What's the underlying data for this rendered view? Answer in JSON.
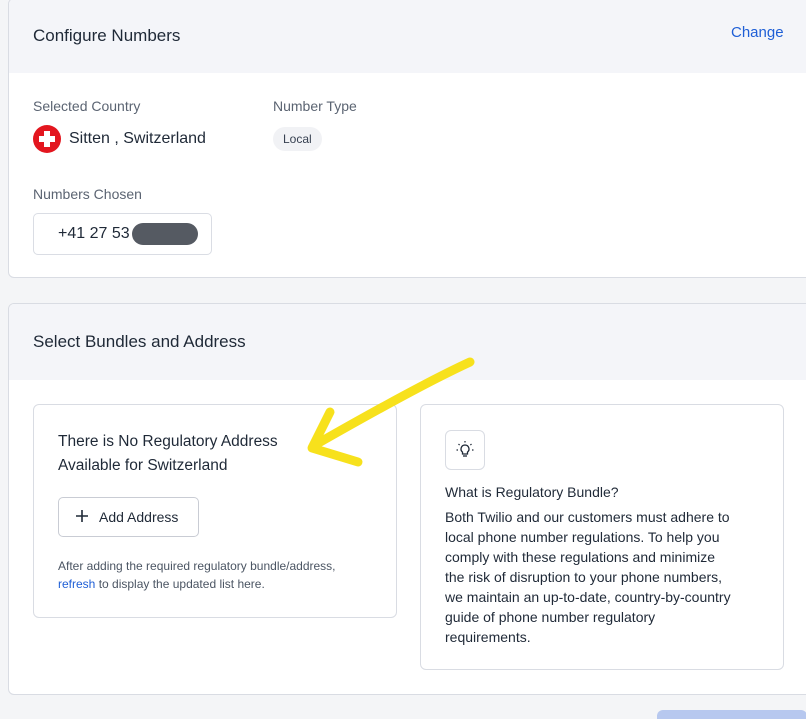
{
  "configure": {
    "title": "Configure Numbers",
    "change_label": "Change",
    "selected_country_label": "Selected Country",
    "country_value": "Sitten , Switzerland",
    "number_type_label": "Number Type",
    "number_type_value": "Local",
    "numbers_chosen_label": "Numbers Chosen",
    "number_prefix": "+41 27 53"
  },
  "bundles": {
    "title": "Select Bundles and Address",
    "no_address_line1": "There is No Regulatory Address",
    "no_address_line2": "Available for Switzerland",
    "add_address_label": "Add Address",
    "hint_line1": "After adding the required regulatory bundle/address,",
    "hint_link": "refresh",
    "hint_line2_rest": " to display the updated list here.",
    "info_title": "What is Regulatory Bundle?",
    "info_lines": [
      "Both Twilio and our customers must adhere to",
      "local phone number regulations. To help you",
      "comply with these regulations and minimize",
      "the risk of disruption to your phone numbers,",
      "we maintain an up-to-date, country-by-country",
      "guide of phone number regulatory",
      "requirements."
    ]
  },
  "icons": {
    "flag": "switzerland-flag-icon",
    "plus": "plus-icon",
    "bulb": "lightbulb-icon",
    "arrow": "annotation-arrow"
  },
  "colors": {
    "accent": "#1f5fd6",
    "annotation": "#f7e11c",
    "flag_red": "#e3161f"
  }
}
